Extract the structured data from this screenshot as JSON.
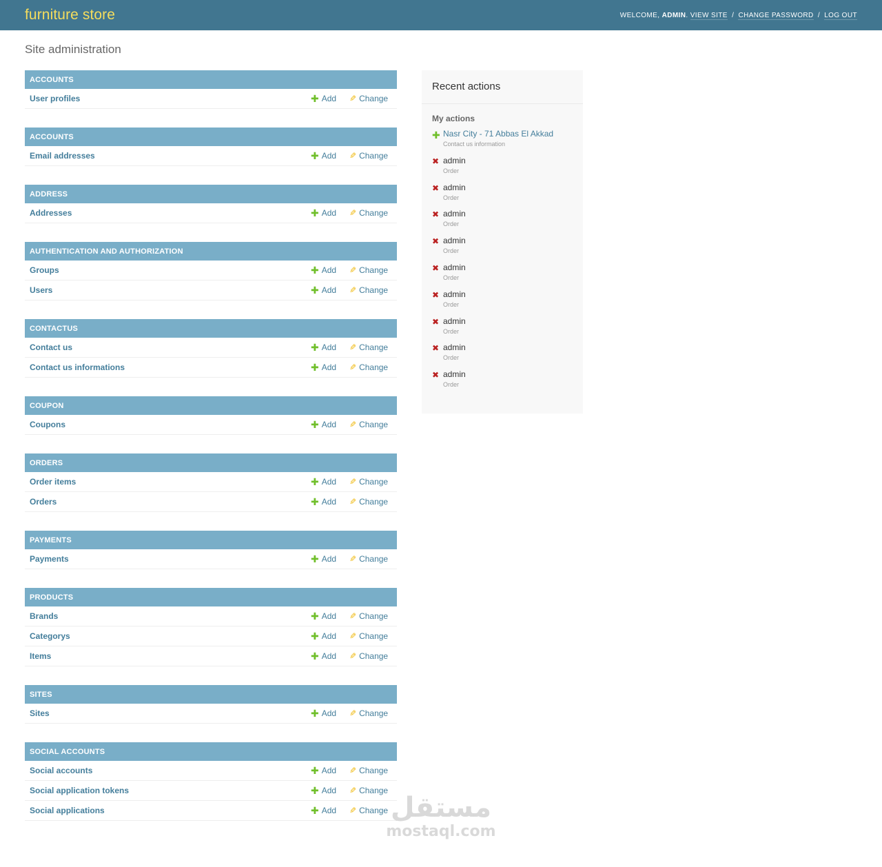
{
  "header": {
    "branding": "furniture store",
    "welcome": "Welcome,",
    "username": "admin",
    "view_site": "View site",
    "change_password": "Change password",
    "log_out": "Log out",
    "separator": "/"
  },
  "page_title": "Site administration",
  "labels": {
    "add": "Add",
    "change": "Change"
  },
  "colors": {
    "header": "#417690",
    "branding": "#f5dd5d",
    "caption": "#79aec8",
    "link": "#447e9b",
    "add": "#70bf2b",
    "change": "#efb80b",
    "delete": "#ba2121"
  },
  "modules": [
    {
      "caption": "Accounts",
      "models": [
        "User profiles"
      ]
    },
    {
      "caption": "Accounts",
      "models": [
        "Email addresses"
      ]
    },
    {
      "caption": "Address",
      "models": [
        "Addresses"
      ]
    },
    {
      "caption": "Authentication and Authorization",
      "models": [
        "Groups",
        "Users"
      ]
    },
    {
      "caption": "Contactus",
      "models": [
        "Contact us",
        "Contact us informations"
      ]
    },
    {
      "caption": "Coupon",
      "models": [
        "Coupons"
      ]
    },
    {
      "caption": "Orders",
      "models": [
        "Order items",
        "Orders"
      ]
    },
    {
      "caption": "Payments",
      "models": [
        "Payments"
      ]
    },
    {
      "caption": "Products",
      "models": [
        "Brands",
        "Categorys",
        "Items"
      ]
    },
    {
      "caption": "Sites",
      "models": [
        "Sites"
      ]
    },
    {
      "caption": "Social Accounts",
      "models": [
        "Social accounts",
        "Social application tokens",
        "Social applications"
      ]
    }
  ],
  "recent_actions": {
    "title": "Recent actions",
    "subtitle": "My actions",
    "items": [
      {
        "icon": "plus-icon",
        "kind": "add",
        "title": "Nasr City - 71 Abbas El Akkad",
        "type": "Contact us information"
      },
      {
        "icon": "delete-icon",
        "kind": "delete",
        "title": "admin",
        "type": "Order"
      },
      {
        "icon": "delete-icon",
        "kind": "delete",
        "title": "admin",
        "type": "Order"
      },
      {
        "icon": "delete-icon",
        "kind": "delete",
        "title": "admin",
        "type": "Order"
      },
      {
        "icon": "delete-icon",
        "kind": "delete",
        "title": "admin",
        "type": "Order"
      },
      {
        "icon": "delete-icon",
        "kind": "delete",
        "title": "admin",
        "type": "Order"
      },
      {
        "icon": "delete-icon",
        "kind": "delete",
        "title": "admin",
        "type": "Order"
      },
      {
        "icon": "delete-icon",
        "kind": "delete",
        "title": "admin",
        "type": "Order"
      },
      {
        "icon": "delete-icon",
        "kind": "delete",
        "title": "admin",
        "type": "Order"
      },
      {
        "icon": "delete-icon",
        "kind": "delete",
        "title": "admin",
        "type": "Order"
      }
    ]
  },
  "watermark": {
    "arabic": "مستقل",
    "latin": "mostaql.com"
  }
}
